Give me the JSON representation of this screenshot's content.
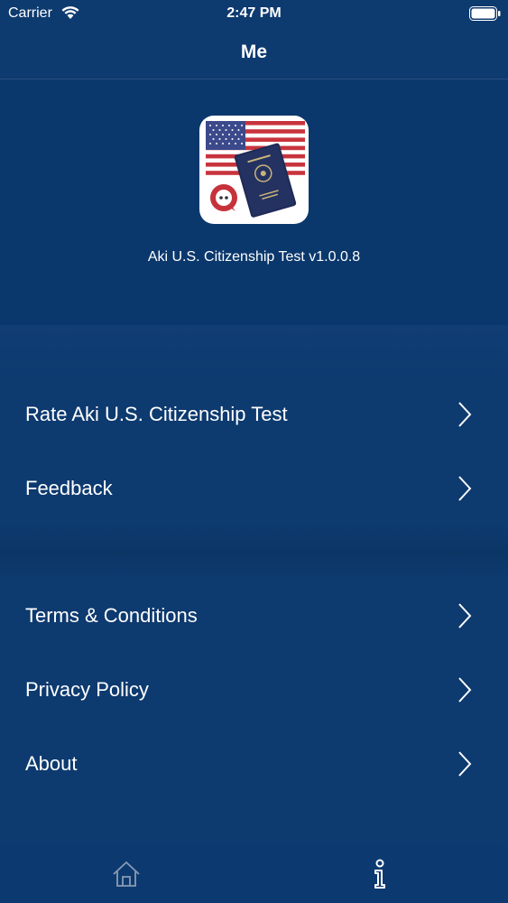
{
  "status_bar": {
    "carrier": "Carrier",
    "time": "2:47 PM"
  },
  "nav": {
    "title": "Me"
  },
  "app_info": {
    "version_text": "Aki U.S. Citizenship Test v1.0.0.8",
    "icon": "app-logo-flag-passport"
  },
  "menu": {
    "group1": [
      {
        "label": "Rate Aki U.S. Citizenship Test",
        "icon": "chevron-right-icon"
      },
      {
        "label": "Feedback",
        "icon": "chevron-right-icon"
      }
    ],
    "group2": [
      {
        "label": "Terms & Conditions",
        "icon": "chevron-right-icon"
      },
      {
        "label": "Privacy Policy",
        "icon": "chevron-right-icon"
      },
      {
        "label": "About",
        "icon": "chevron-right-icon"
      }
    ]
  },
  "tab_bar": {
    "tabs": [
      {
        "icon": "home-icon",
        "selected": false
      },
      {
        "icon": "info-icon",
        "selected": true
      }
    ]
  },
  "colors": {
    "background": "#0d3a6f",
    "text": "#ffffff",
    "tab_inactive": "#8a9bb3",
    "tab_active": "#ffffff"
  }
}
